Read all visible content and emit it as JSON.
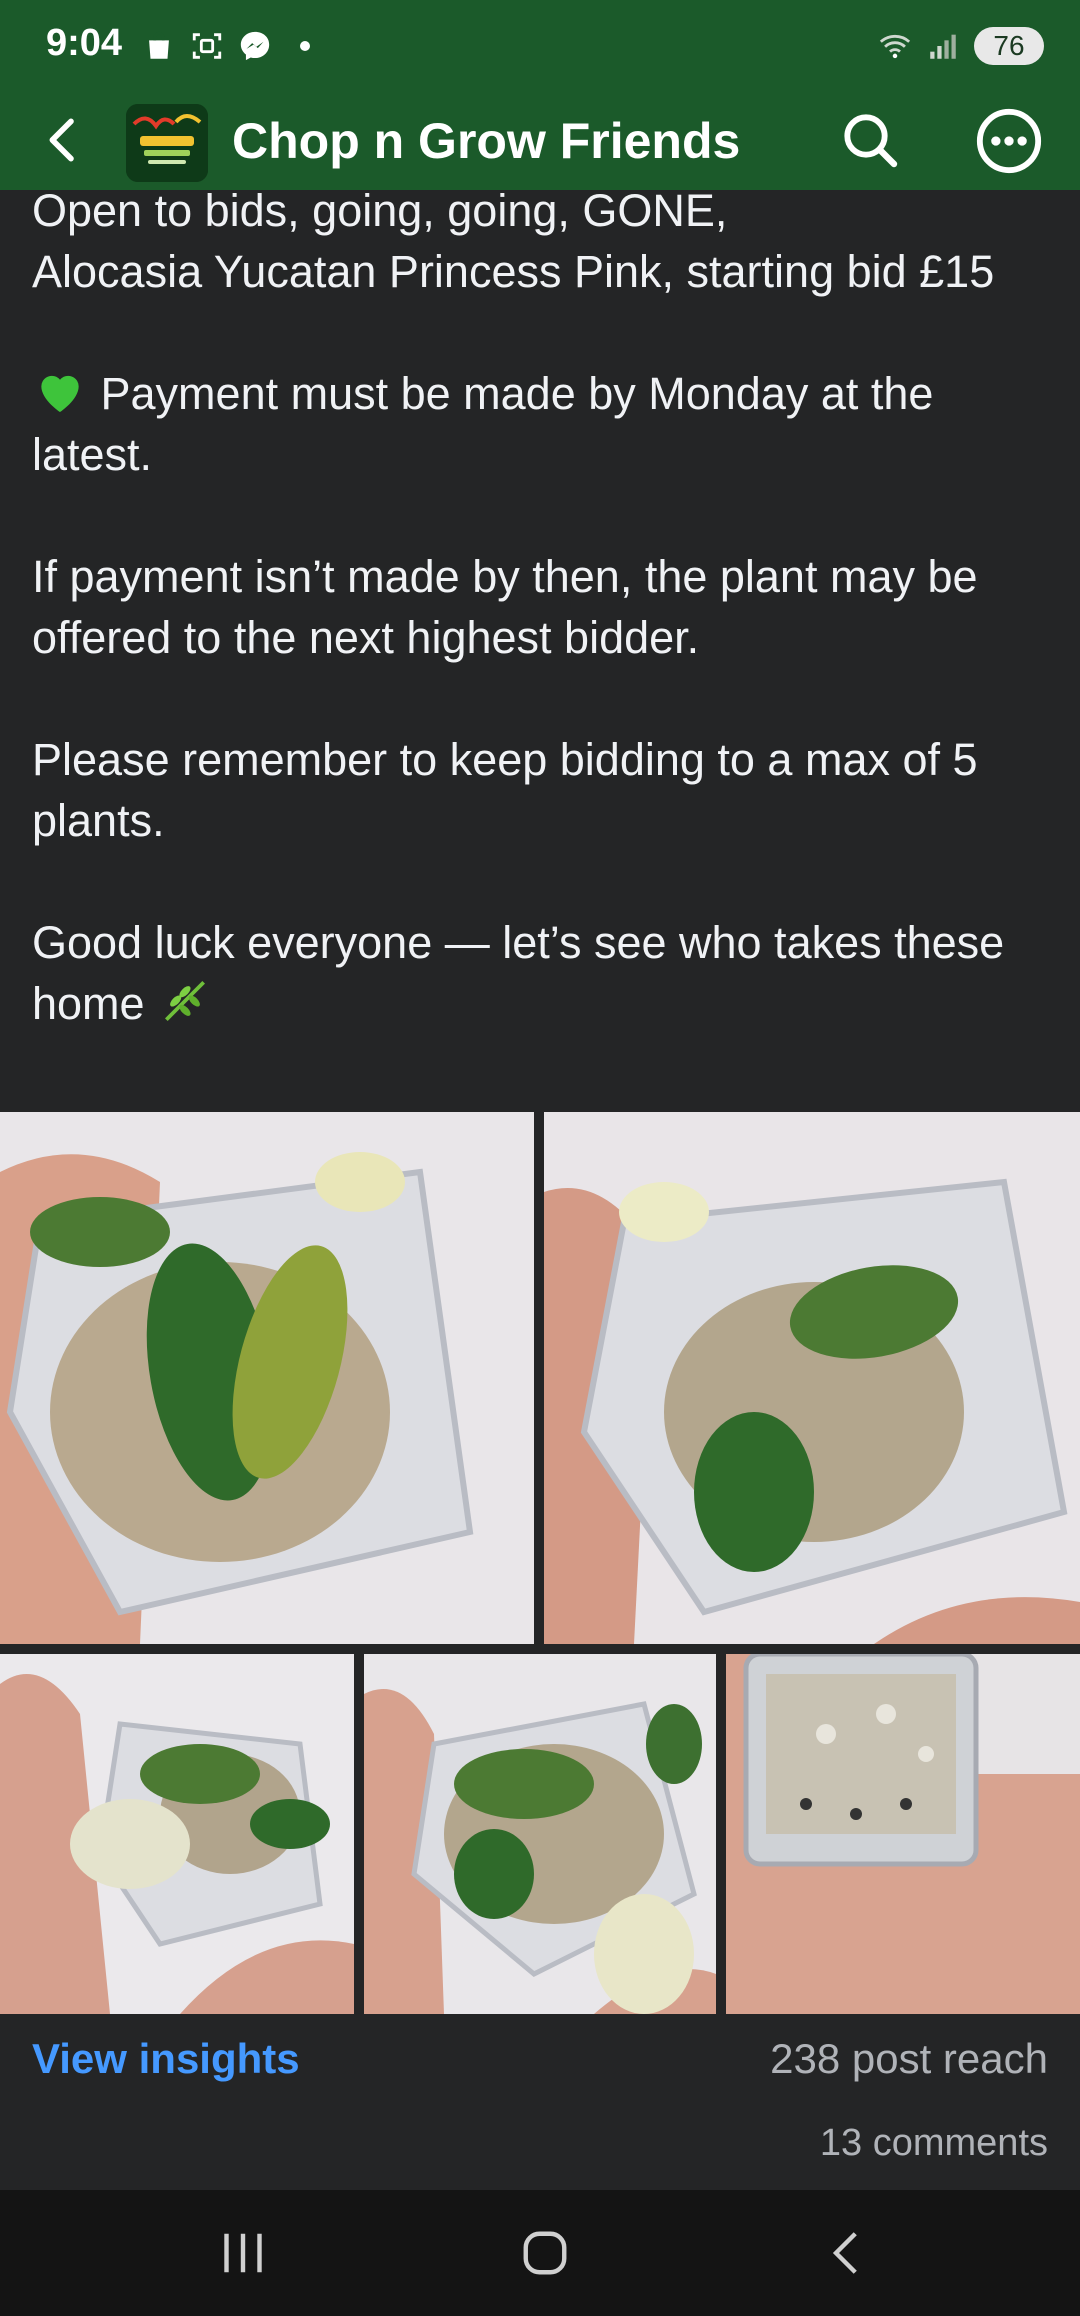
{
  "status_bar": {
    "time": "9:04",
    "battery": "76",
    "icons": [
      "shopping-bag-icon",
      "screenshot-icon",
      "messenger-icon",
      "notification-dot-icon",
      "wifi-icon",
      "signal-icon",
      "battery-icon"
    ]
  },
  "header": {
    "group_name": "Chop n Grow Friends",
    "back_icon": "back-arrow-icon",
    "search_icon": "search-icon",
    "more_icon": "more-options-icon",
    "colors": {
      "bar": "#1b5a2a"
    }
  },
  "post": {
    "lines": [
      "Open to bids, going, going, GONE,",
      "Alocasia Yucatan Princess Pink, starting bid £15"
    ],
    "payment": "Payment must be made by Monday at the latest.",
    "payment_emoji": "green-heart-icon",
    "warning": "If payment isn’t made by then, the plant may be offered to the next highest bidder.",
    "limit": "Please remember to keep bidding to a max of 5 plants.",
    "good_luck": "Good luck everyone — let’s see who takes these home",
    "good_luck_emoji": "herb-icon"
  },
  "photos": {
    "count": 5,
    "subjects": [
      "variegated-alocasia-top-view",
      "variegated-alocasia-side-view",
      "white-leaf-alocasia",
      "alocasia-in-pot-hand",
      "pot-bottom-roots"
    ]
  },
  "footer": {
    "insights_label": "View insights",
    "reach": "238 post reach",
    "comments": "13 comments",
    "accent": "#4599ff"
  },
  "nav_bar": {
    "buttons": [
      "recent-apps-icon",
      "home-icon",
      "back-icon"
    ]
  }
}
